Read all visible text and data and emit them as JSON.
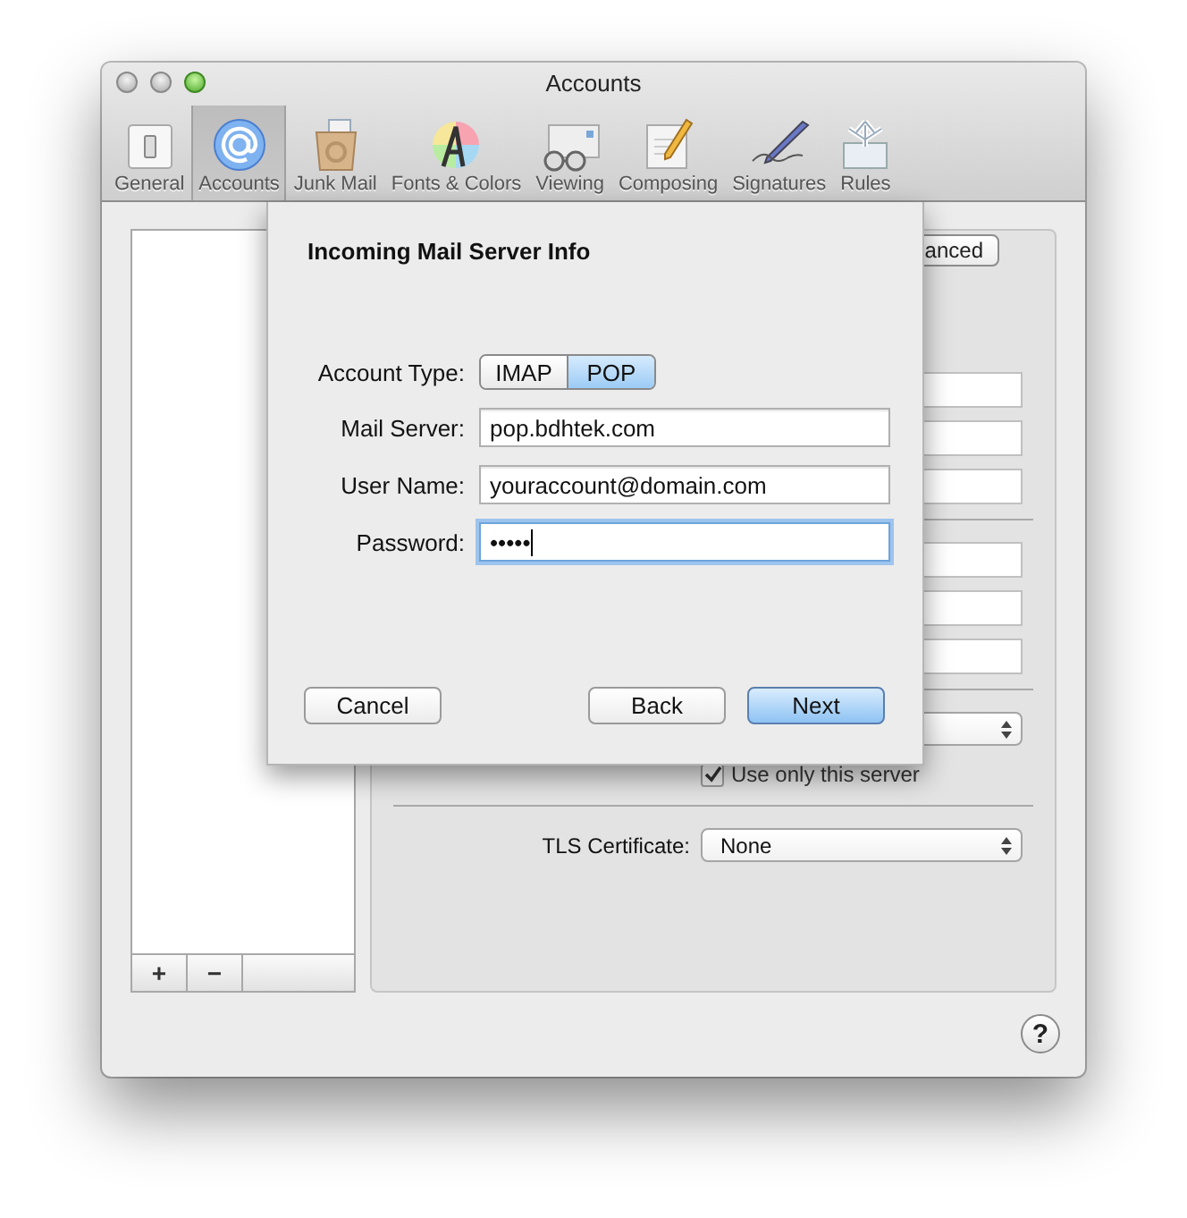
{
  "window": {
    "title": "Accounts"
  },
  "toolbar": [
    {
      "label": "General",
      "selected": false
    },
    {
      "label": "Accounts",
      "selected": true
    },
    {
      "label": "Junk Mail",
      "selected": false
    },
    {
      "label": "Fonts & Colors",
      "selected": false
    },
    {
      "label": "Viewing",
      "selected": false
    },
    {
      "label": "Composing",
      "selected": false
    },
    {
      "label": "Signatures",
      "selected": false
    },
    {
      "label": "Rules",
      "selected": false
    }
  ],
  "account_list": {
    "buttons": [
      "+",
      "−"
    ]
  },
  "tabs": [
    {
      "label": "anced",
      "selected": false
    }
  ],
  "use_only_this_server": {
    "label": "Use only this server",
    "checked": true
  },
  "tls_certificate": {
    "label": "TLS Certificate:",
    "value": "None"
  },
  "sheet": {
    "title": "Incoming Mail Server Info",
    "account_type": {
      "label": "Account Type:",
      "options": [
        {
          "label": "IMAP",
          "selected": false
        },
        {
          "label": "POP",
          "selected": true
        }
      ]
    },
    "fields": [
      {
        "label": "Mail Server:",
        "value": "pop.bdhtek.com",
        "focused": false
      },
      {
        "label": "User Name:",
        "value": "youraccount@domain.com",
        "focused": false
      },
      {
        "label": "Password:",
        "value": "•••••",
        "focused": true
      }
    ],
    "buttons": [
      {
        "label": "Cancel",
        "default": false
      },
      {
        "label": "Back",
        "default": false
      },
      {
        "label": "Next",
        "default": true
      }
    ]
  },
  "help_button": "?"
}
